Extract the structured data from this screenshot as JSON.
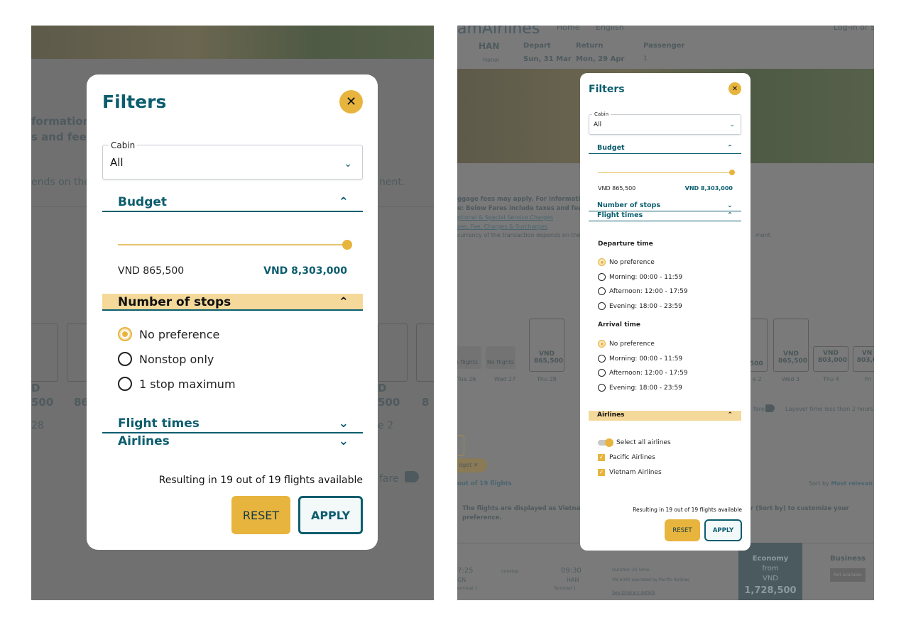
{
  "colors": {
    "accent": "#e7b43e",
    "primary": "#0b5d6e",
    "highlight": "#f4d99a"
  },
  "left": {
    "background": {
      "fragments": [
        "formation",
        "s and fees",
        "ends on the",
        "nent.",
        "D",
        "500",
        "86",
        "28",
        "e 2",
        "D",
        "500",
        "8",
        "fare"
      ]
    },
    "modal": {
      "title": "Filters",
      "close_icon": "close-icon",
      "cabin": {
        "label": "Cabin",
        "value": "All"
      },
      "budget": {
        "label": "Budget",
        "min": "VND 865,500",
        "max": "VND 8,303,000",
        "slider_value_fraction": 1.0
      },
      "stops": {
        "label": "Number of stops",
        "options": [
          {
            "label": "No preference",
            "selected": true
          },
          {
            "label": "Nonstop only",
            "selected": false
          },
          {
            "label": "1 stop maximum",
            "selected": false
          }
        ]
      },
      "flight_times": {
        "label": "Flight times"
      },
      "airlines": {
        "label": "Airlines"
      },
      "result": "Resulting in 19 out of 19 flights available",
      "reset": "RESET",
      "apply": "APPLY"
    }
  },
  "right": {
    "background": {
      "logo": "amAirlines",
      "nav": [
        "Home",
        "English",
        "Log-in or Sig"
      ],
      "origin": "HAN",
      "origin_city": "Hanoi",
      "depart_label": "Depart",
      "depart": "Sun, 31 Mar",
      "return_label": "Return",
      "return": "Mon, 29 Apr",
      "passenger_label": "Passenger",
      "passenger": "1",
      "info": [
        "ggage fees may apply. For information",
        "e: Below Fares include taxes and fees",
        "ptional & Special Service Charges",
        "xes, Fee, Charges & Surcharges",
        "currency of the transaction depends on the",
        "ment."
      ],
      "dates": [
        {
          "price": "",
          "label": "Tue 26",
          "nf": "o flights"
        },
        {
          "price": "",
          "label": "Wed 27",
          "nf": "No flights"
        },
        {
          "price": "VND 865,500",
          "label": "Thu 28"
        },
        {
          "price": "VND 865,500",
          "label": "Wed 3"
        },
        {
          "price": "VND 803,000",
          "label": "Thu 4"
        },
        {
          "price": "VN 803,0",
          "label": "Fri"
        }
      ],
      "partial_date": {
        "price": "D 500",
        "label": "e 2"
      },
      "fare_tag": "fare",
      "layover": "Layover time less than 2 hours",
      "chip": "dget",
      "count": "out of 19 flights",
      "sort_label": "Sort by",
      "sort_value": "Most relevan",
      "notice": "The flights are displayed as Vietnam",
      "notice2": "preference.",
      "notice3": "r (Sort by) to customize your",
      "flight": {
        "dep": "7:25",
        "arr": "09:30",
        "stops": "nonstop",
        "from": "GN",
        "to": "HAN",
        "t1": "erminal 1",
        "t2": "Terminal 1",
        "duration": "Duration 2h 5min",
        "op": "VN 6030  operated by Pacific Airlines",
        "details": "See itinerary details"
      },
      "economy": {
        "label": "Economy",
        "from": "from",
        "cur": "VND",
        "price": "1,728,500"
      },
      "business": {
        "label": "Business",
        "na": "Not available"
      }
    },
    "modal": {
      "title": "Filters",
      "cabin": {
        "label": "Cabin",
        "value": "All"
      },
      "budget": {
        "label": "Budget",
        "min": "VND 865,500",
        "max": "VND 8,303,000",
        "slider_value_fraction": 1.0
      },
      "stops": {
        "label": "Number of stops"
      },
      "flight_times": {
        "label": "Flight times",
        "departure": {
          "label": "Departure time",
          "options": [
            {
              "label": "No preference",
              "selected": true
            },
            {
              "label": "Morning: 00:00 - 11:59"
            },
            {
              "label": "Afternoon: 12:00 - 17:59"
            },
            {
              "label": "Evening: 18:00 - 23:59"
            }
          ]
        },
        "arrival": {
          "label": "Arrival time",
          "options": [
            {
              "label": "No preference",
              "selected": true
            },
            {
              "label": "Morning: 00:00 - 11:59"
            },
            {
              "label": "Afternoon: 12:00 - 17:59"
            },
            {
              "label": "Evening: 18:00 - 23:59"
            }
          ]
        }
      },
      "airlines": {
        "label": "Airlines",
        "select_all": "Select all airlines",
        "select_all_on": true,
        "items": [
          {
            "label": "Pacific Airlines",
            "checked": true
          },
          {
            "label": "Vietnam Airlines",
            "checked": true
          }
        ]
      },
      "result": "Resulting in 19 out of 19 flights available",
      "reset": "RESET",
      "apply": "APPLY"
    }
  }
}
